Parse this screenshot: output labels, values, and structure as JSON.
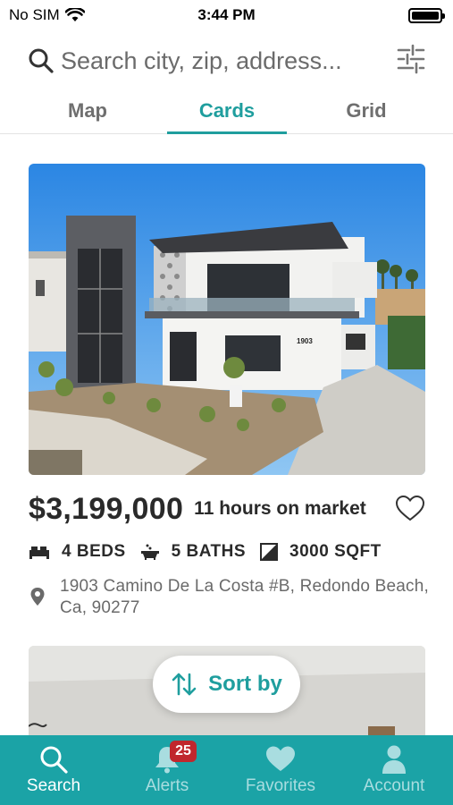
{
  "status_bar": {
    "carrier": "No SIM",
    "time": "3:44 PM",
    "battery_level": 1.0
  },
  "search": {
    "placeholder": "Search city, zip, address..."
  },
  "tabs": [
    {
      "label": "Map",
      "active": false
    },
    {
      "label": "Cards",
      "active": true
    },
    {
      "label": "Grid",
      "active": false
    }
  ],
  "listing": {
    "price": "$3,199,000",
    "time_on_market": "11 hours on market",
    "beds": "4 BEDS",
    "baths": "5 BATHS",
    "sqft": "3000 SQFT",
    "address_line1": "1903 Camino De La Costa #B, Redondo Beach,",
    "address_line2": "Ca, 90277",
    "house_number_sign": "1903"
  },
  "sort": {
    "label": "Sort by"
  },
  "bottom_nav": {
    "items": [
      {
        "label": "Search",
        "icon": "search-icon",
        "active": true
      },
      {
        "label": "Alerts",
        "icon": "bell-icon",
        "active": false,
        "badge": "25"
      },
      {
        "label": "Favorites",
        "icon": "heart-icon",
        "active": false
      },
      {
        "label": "Account",
        "icon": "person-icon",
        "active": false
      }
    ]
  },
  "colors": {
    "accent": "#1f9e9e",
    "nav_background": "#1ba3a6",
    "badge": "#c0272d"
  }
}
